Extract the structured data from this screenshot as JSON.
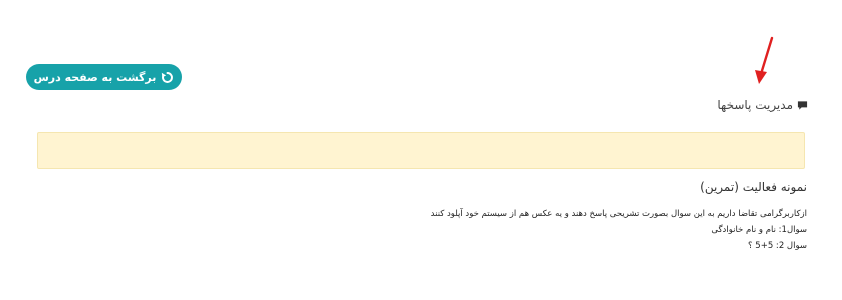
{
  "back_button": {
    "label": "برگشت به صفحه درس",
    "icon": "refresh-icon",
    "color": "#17a2a9"
  },
  "annotation": {
    "icon": "red-arrow-icon",
    "color": "#e02020"
  },
  "section": {
    "title": "مدیریت پاسخها",
    "icon": "comment-icon"
  },
  "alert": {
    "color": "#fff4d1"
  },
  "activity": {
    "title": "نمونه فعالیت (تمرین)",
    "lines": [
      "ازکاربرگرامی تقاضا داریم به این سوال بصورت تشریحی پاسخ دهند و یه عکس هم از سیستم خود آپلود کنند",
      "سوال1: نام و نام خانوادگی",
      "سوال 2: 5+5 ؟"
    ]
  }
}
